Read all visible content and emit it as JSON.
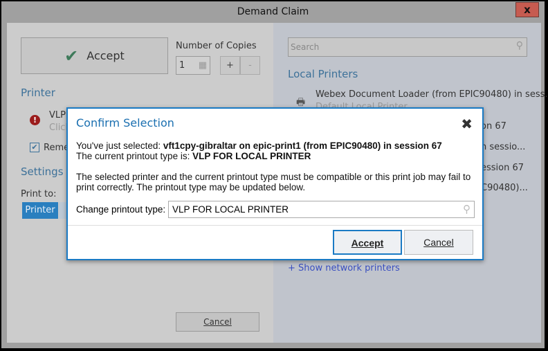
{
  "window": {
    "title": "Demand Claim",
    "close": "x"
  },
  "left": {
    "accept_label": "Accept",
    "copies_label": "Number of Copies",
    "copies_value": "1",
    "plus": "+",
    "minus": "-",
    "printer_heading": "Printer",
    "printer_name": "VLP",
    "printer_hint": "Click",
    "remember": "Reme",
    "settings_heading": "Settings",
    "print_to_label": "Print to:",
    "print_to_option": "Printer",
    "cancel_label": "Cancel"
  },
  "right": {
    "search_placeholder": "Search",
    "local_heading": "Local Printers",
    "printers": [
      {
        "name": "Webex Document Loader (from EPIC90480) in sess...",
        "sub": "Default Local Printer"
      },
      {
        "name": "on 67"
      },
      {
        "name": "n sessio..."
      },
      {
        "name": "ession 67"
      },
      {
        "name": "C90480)..."
      }
    ],
    "show_network": "+ Show network printers"
  },
  "dialog": {
    "title": "Confirm Selection",
    "close": "✖",
    "line1_prefix": "You've just selected: ",
    "line1_bold": "vft1cpy-gibraltar on epic-print1 (from EPIC90480) in session 67",
    "line2_prefix": "The current printout type is: ",
    "line2_bold": "VLP FOR LOCAL PRINTER",
    "warning": "The selected printer and the current printout type must be compatible or this print job may fail to print correctly. The printout type may be updated below.",
    "change_label": "Change printout type:",
    "change_value": "VLP FOR LOCAL PRINTER",
    "accept": "Accept",
    "cancel": "Cancel"
  }
}
